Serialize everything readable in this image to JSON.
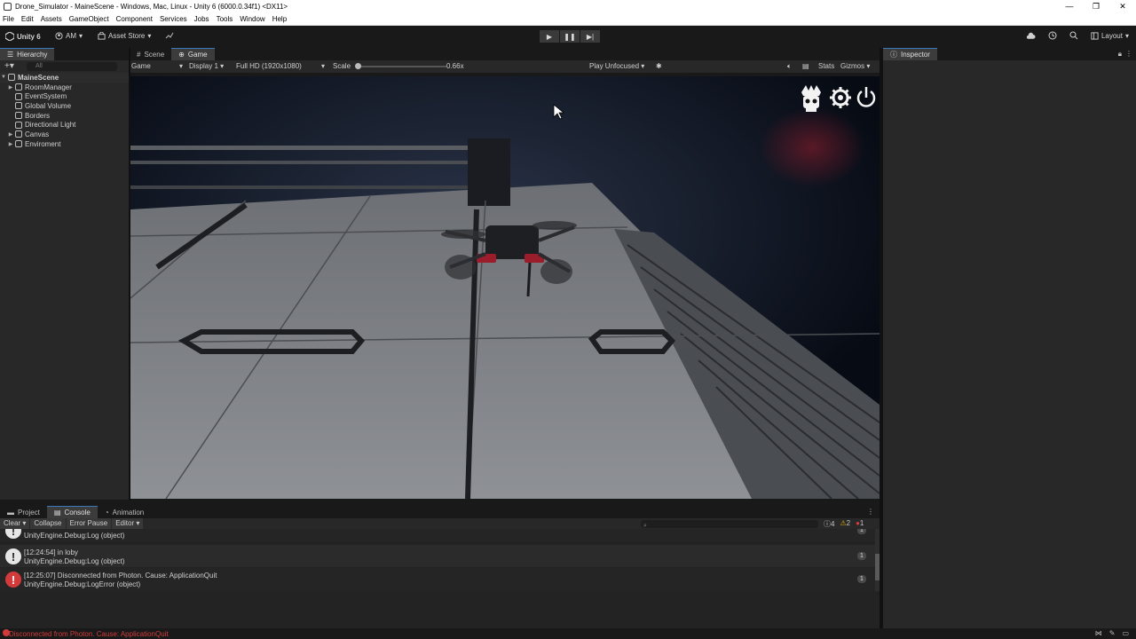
{
  "window": {
    "title": "Drone_Simulator - MaineScene - Windows, Mac, Linux - Unity 6 (6000.0.34f1) <DX11>",
    "controls": [
      "—",
      "❐",
      "✕"
    ]
  },
  "menubar": {
    "items": [
      "File",
      "Edit",
      "Assets",
      "GameObject",
      "Component",
      "Services",
      "Jobs",
      "Tools",
      "Window",
      "Help"
    ]
  },
  "toolbar": {
    "unity_label": "Unity 6",
    "account_label": "AM",
    "asset_store_label": "Asset Store",
    "layout_label": "Layout"
  },
  "hierarchy": {
    "tab_label": "Hierarchy",
    "search_placeholder": "All",
    "root": "MaineScene",
    "items": [
      "RoomManager",
      "EventSystem",
      "Global Volume",
      "Borders",
      "Directional Light",
      "Canvas",
      "Enviroment"
    ]
  },
  "center_tabs": {
    "scene": "Scene",
    "game": "Game"
  },
  "game_toolbar": {
    "mode": "Game",
    "display": "Display 1",
    "resolution": "Full HD (1920x1080)",
    "scale_label": "Scale",
    "scale_value": "0.66x",
    "play_mode": "Play Unfocused",
    "stats": "Stats",
    "gizmos": "Gizmos"
  },
  "inspector": {
    "tab_label": "Inspector"
  },
  "bottom_tabs": {
    "project": "Project",
    "console": "Console",
    "animation": "Animation"
  },
  "console": {
    "clear": "Clear",
    "collapse": "Collapse",
    "error_pause": "Error Pause",
    "editor": "Editor",
    "counts": {
      "log": "4",
      "warn": "2",
      "error": "1"
    },
    "entries": [
      {
        "type": "log",
        "line2": "UnityEngine.Debug:Log (object)",
        "count": "1"
      },
      {
        "type": "log",
        "line1": "[12:24:54] in loby",
        "line2": "UnityEngine.Debug:Log (object)",
        "count": "1"
      },
      {
        "type": "error",
        "line1": "[12:25:07] Disconnected from Photon. Cause: ApplicationQuit",
        "line2": "UnityEngine.Debug:LogError (object)",
        "count": "1"
      }
    ]
  },
  "status_bar": {
    "message": "Disconnected from Photon. Cause: ApplicationQuit"
  },
  "colors": {
    "accent": "#3a79bb",
    "error": "#d23b3b",
    "warning": "#e0b000"
  }
}
